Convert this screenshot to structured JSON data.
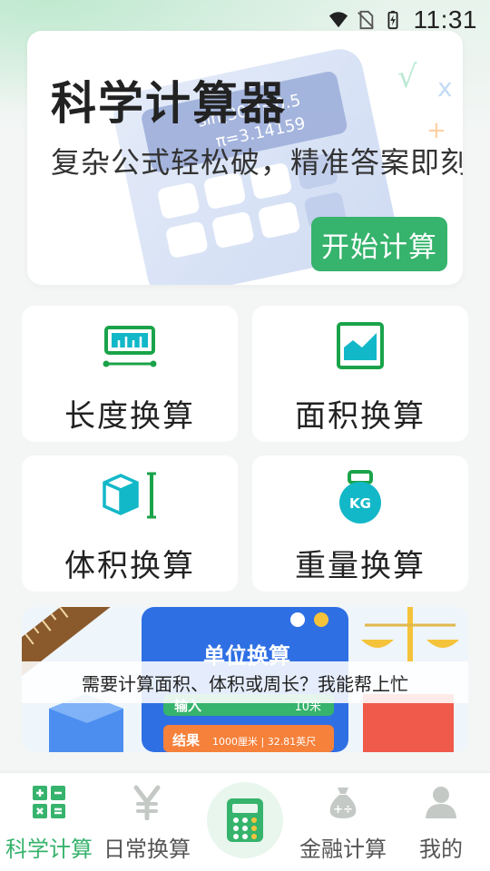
{
  "status_bar": {
    "time": "11:31",
    "icons": [
      "wifi-icon",
      "no-sim-icon",
      "battery-icon"
    ]
  },
  "hero": {
    "title": "科学计算器",
    "subtitle": "复杂公式轻松破，精准答案即刻",
    "button_label": "开始计算",
    "art_text": [
      "sin(30°)=0.5",
      "π=3.14159"
    ]
  },
  "tools": [
    {
      "label": "长度换算",
      "icon": "ruler-icon"
    },
    {
      "label": "面积换算",
      "icon": "area-icon"
    },
    {
      "label": "体积换算",
      "icon": "cube-icon"
    },
    {
      "label": "重量换算",
      "icon": "weight-kg-icon",
      "icon_text": "KG"
    }
  ],
  "banner": {
    "caption": "需要计算面积、体积或周长？我能帮上忙",
    "art_title": "单位换算",
    "art_input_label": "输入",
    "art_input_value": "10米",
    "art_result_label": "结果",
    "art_result_value": "1000厘米 | 32.81英尺"
  },
  "bottom_nav": {
    "items": [
      {
        "label": "科学计算",
        "icon": "calculator-grid-icon",
        "active": true
      },
      {
        "label": "日常换算",
        "icon": "yen-icon",
        "active": false
      },
      {
        "label": "",
        "icon": "calculator-center-icon",
        "active": false
      },
      {
        "label": "金融计算",
        "icon": "money-bag-icon",
        "active": false
      },
      {
        "label": "我的",
        "icon": "person-icon",
        "active": false
      }
    ]
  },
  "colors": {
    "accent": "#36b36c",
    "tool_icon": "#1aa34a",
    "tool_icon_cyan": "#13b8c8"
  }
}
